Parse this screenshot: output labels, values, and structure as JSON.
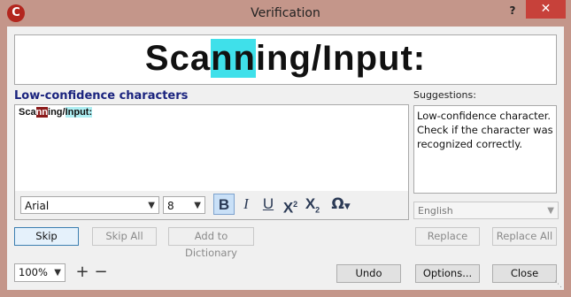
{
  "window": {
    "title": "Verification",
    "app_icon_glyph": "C",
    "help_glyph": "?",
    "close_glyph": "✕"
  },
  "preview": {
    "before": "Sca",
    "highlight": "nn",
    "after": "ing/Input:"
  },
  "lowconf": {
    "label": "Low-confidence characters",
    "text_plain_start": "Sca",
    "text_dark": "nn",
    "text_mid": "ing/",
    "text_cyan": "Input:"
  },
  "toolbar": {
    "font_value": "Arial",
    "size_value": "8",
    "bold_glyph": "B",
    "italic_glyph": "I",
    "underline_glyph": "U",
    "superscript_base": "X",
    "superscript_mark": "2",
    "subscript_base": "X",
    "subscript_mark": "2",
    "special_char_glyph": "Ω"
  },
  "suggestions": {
    "label": "Suggestions:",
    "text": "Low-confidence character. Check if the character was recognized correctly.",
    "language_value": "English"
  },
  "buttons": {
    "skip": "Skip",
    "skip_all": "Skip All",
    "add_to_dictionary": "Add to Dictionary",
    "replace": "Replace",
    "replace_all": "Replace All",
    "undo": "Undo",
    "options": "Options...",
    "close": "Close"
  },
  "zoom": {
    "value": "100%",
    "plus": "+",
    "minus": "−"
  }
}
